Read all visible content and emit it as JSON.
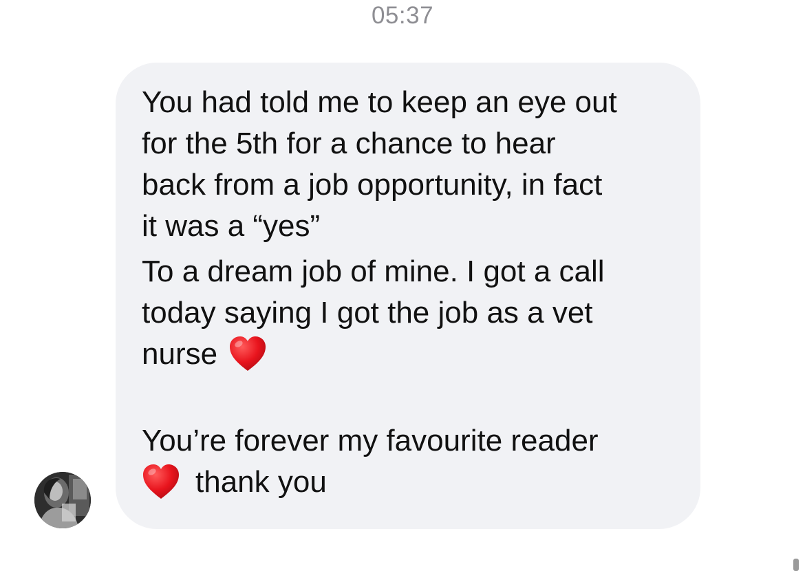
{
  "conversation": {
    "timestamp": "05:37"
  },
  "message": {
    "lines_p1": [
      "You had told me to keep an eye out",
      "for the 5th for a chance to hear",
      "back from a job opportunity, in fact",
      "it was a “yes”"
    ],
    "lines_p2": [
      "To a dream job of mine. I got a call",
      "today saying I got the job as a vet",
      "nurse"
    ],
    "lines_p3": [
      "You’re forever my favourite reader",
      "thank you"
    ],
    "heart_emoji": "red-heart-icon"
  },
  "colors": {
    "bubble_bg": "#f1f2f5",
    "text": "#111111",
    "timestamp": "#8e8e93",
    "heart": "#e8141d"
  }
}
